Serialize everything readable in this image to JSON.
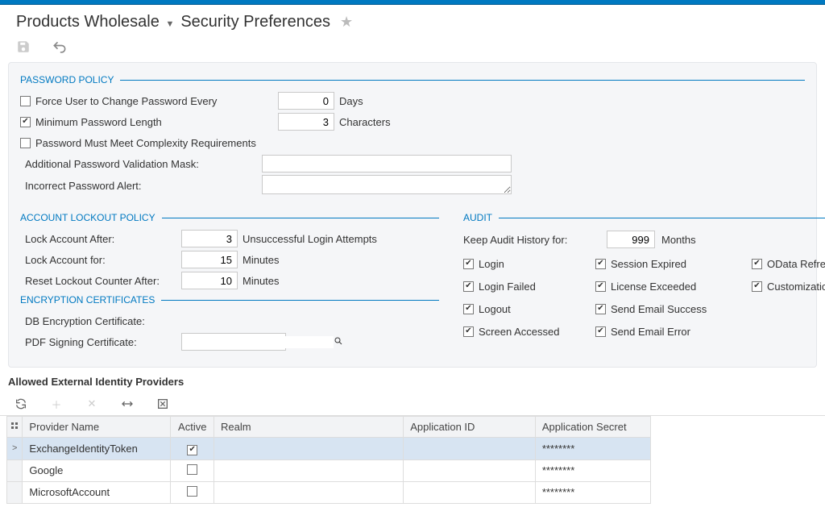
{
  "breadcrumb": {
    "workspace": "Products Wholesale",
    "page": "Security Preferences"
  },
  "icons": {
    "save": "save-icon",
    "undo": "undo-icon",
    "star": "star-icon"
  },
  "password_policy": {
    "title": "PASSWORD POLICY",
    "force_change": {
      "checked": false,
      "label": "Force User to Change Password Every",
      "value": "0",
      "unit": "Days"
    },
    "min_length": {
      "checked": true,
      "label": "Minimum Password Length",
      "value": "3",
      "unit": "Characters"
    },
    "complexity": {
      "checked": false,
      "label": "Password Must Meet Complexity Requirements"
    },
    "mask_label": "Additional Password Validation Mask:",
    "mask_value": "",
    "alert_label": "Incorrect Password Alert:",
    "alert_value": ""
  },
  "lockout_policy": {
    "title": "ACCOUNT LOCKOUT POLICY",
    "lock_after": {
      "label": "Lock Account After:",
      "value": "3",
      "unit": "Unsuccessful Login Attempts"
    },
    "lock_for": {
      "label": "Lock Account for:",
      "value": "15",
      "unit": "Minutes"
    },
    "reset_after": {
      "label": "Reset Lockout Counter After:",
      "value": "10",
      "unit": "Minutes"
    }
  },
  "encryption": {
    "title": "ENCRYPTION CERTIFICATES",
    "db_cert_label": "DB Encryption Certificate:",
    "pdf_cert_label": "PDF Signing Certificate:",
    "pdf_cert_value": ""
  },
  "audit": {
    "title": "AUDIT",
    "keep_history": {
      "label": "Keep Audit History for:",
      "value": "999",
      "unit": "Months"
    },
    "items": [
      {
        "label": "Login",
        "checked": true
      },
      {
        "label": "Session Expired",
        "checked": true
      },
      {
        "label": "OData Refresh",
        "checked": true
      },
      {
        "label": "Login Failed",
        "checked": true
      },
      {
        "label": "License Exceeded",
        "checked": true
      },
      {
        "label": "Customization Published",
        "checked": true
      },
      {
        "label": "Logout",
        "checked": true
      },
      {
        "label": "Send Email Success",
        "checked": true
      },
      {
        "label": "",
        "checked": null
      },
      {
        "label": "Screen Accessed",
        "checked": true
      },
      {
        "label": "Send Email Error",
        "checked": true
      },
      {
        "label": "",
        "checked": null
      }
    ]
  },
  "providers": {
    "title": "Allowed External Identity Providers",
    "columns": {
      "provider": "Provider Name",
      "active": "Active",
      "realm": "Realm",
      "appid": "Application ID",
      "secret": "Application Secret"
    },
    "rows": [
      {
        "provider": "ExchangeIdentityToken",
        "active": true,
        "realm": "",
        "appid": "",
        "secret": "********",
        "selected": true
      },
      {
        "provider": "Google",
        "active": false,
        "realm": "",
        "appid": "",
        "secret": "********",
        "selected": false
      },
      {
        "provider": "MicrosoftAccount",
        "active": false,
        "realm": "",
        "appid": "",
        "secret": "********",
        "selected": false
      }
    ]
  }
}
